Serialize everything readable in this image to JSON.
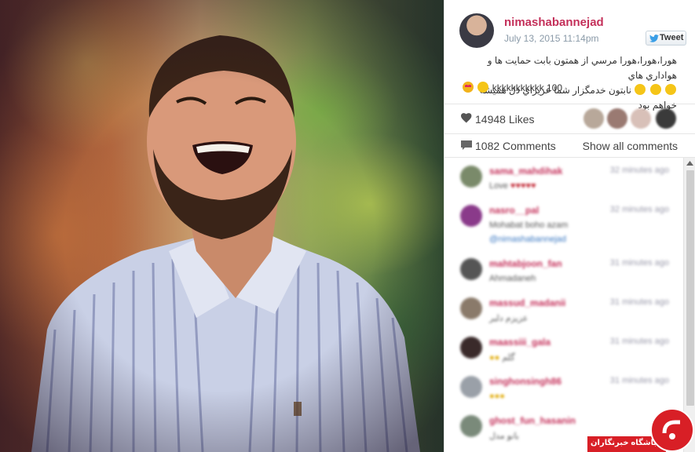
{
  "post": {
    "username": "nimashabannejad",
    "date": "July 13, 2015 11:14pm",
    "tweet_label": "Tweet",
    "caption_line1": "هورا،هورا،هورا مرسي از همتون بابت حمايت ها و هواداري هاي",
    "caption_line2": "نابتون خدمگزار شما عزيزاي دل هميشه خواهم بود",
    "caption_line3": "kkkkkkkkkkk 100"
  },
  "likes": {
    "label": "14948 Likes"
  },
  "comments_bar": {
    "count_label": "1082 Comments",
    "show_all": "Show all comments"
  },
  "comments": [
    {
      "user": "sama_mahdihak",
      "time": "32 minutes ago",
      "text": "Love",
      "avatar_color": "#7a8a6a"
    },
    {
      "user": "nasro__pal",
      "time": "32 minutes ago",
      "text": "Mohabat boho azam",
      "text2": "@nimashabannejad",
      "avatar_color": "#8a3a8a"
    },
    {
      "user": "mahtabjoon_fan",
      "time": "31 minutes ago",
      "text": "Ahmadaneh",
      "avatar_color": "#555555"
    },
    {
      "user": "massud_madanii",
      "time": "31 minutes ago",
      "text": "عزيزم دلبر",
      "avatar_color": "#8a7a6a"
    },
    {
      "user": "maassiii_gala",
      "time": "31 minutes ago",
      "text": "گلم",
      "avatar_color": "#3a2a2a"
    },
    {
      "user": "singhonsingh86",
      "time": "31 minutes ago",
      "text": "",
      "avatar_color": "#9aa0a8"
    },
    {
      "user": "ghost_fun_hasanin",
      "time": "",
      "text": "بانو مدل",
      "avatar_color": "#7a8a7a"
    }
  ],
  "watermark": {
    "text": "باشگاه خبرنگاران"
  },
  "colors": {
    "username": "#c4305a",
    "muted": "#8a9aa8",
    "watermark": "#d81f26"
  }
}
